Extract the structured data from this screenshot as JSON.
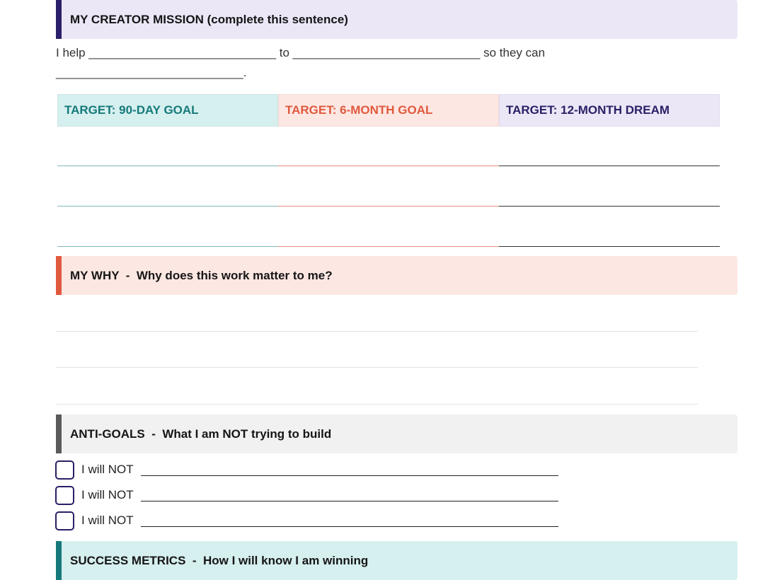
{
  "mission": {
    "heading": "MY CREATOR MISSION (complete this sentence)",
    "sentence": "I help ____________________________ to ____________________________ so they can ____________________________."
  },
  "targets": [
    {
      "label": "TARGET: 90-DAY GOAL",
      "color": "#157a7a"
    },
    {
      "label": "TARGET: 6-MONTH GOAL",
      "color": "#e0593e"
    },
    {
      "label": "TARGET: 12-MONTH DREAM",
      "color": "#2a1f66"
    }
  ],
  "why": {
    "heading": "MY WHY  -  Why does this work matter to me?"
  },
  "anti_goals": {
    "heading": "ANTI-GOALS  -  What I am NOT trying to build",
    "items": [
      {
        "label": "I will NOT"
      },
      {
        "label": "I will NOT"
      },
      {
        "label": "I will NOT"
      }
    ]
  },
  "metrics": {
    "heading": "SUCCESS METRICS  -  How I will know I am winning"
  }
}
